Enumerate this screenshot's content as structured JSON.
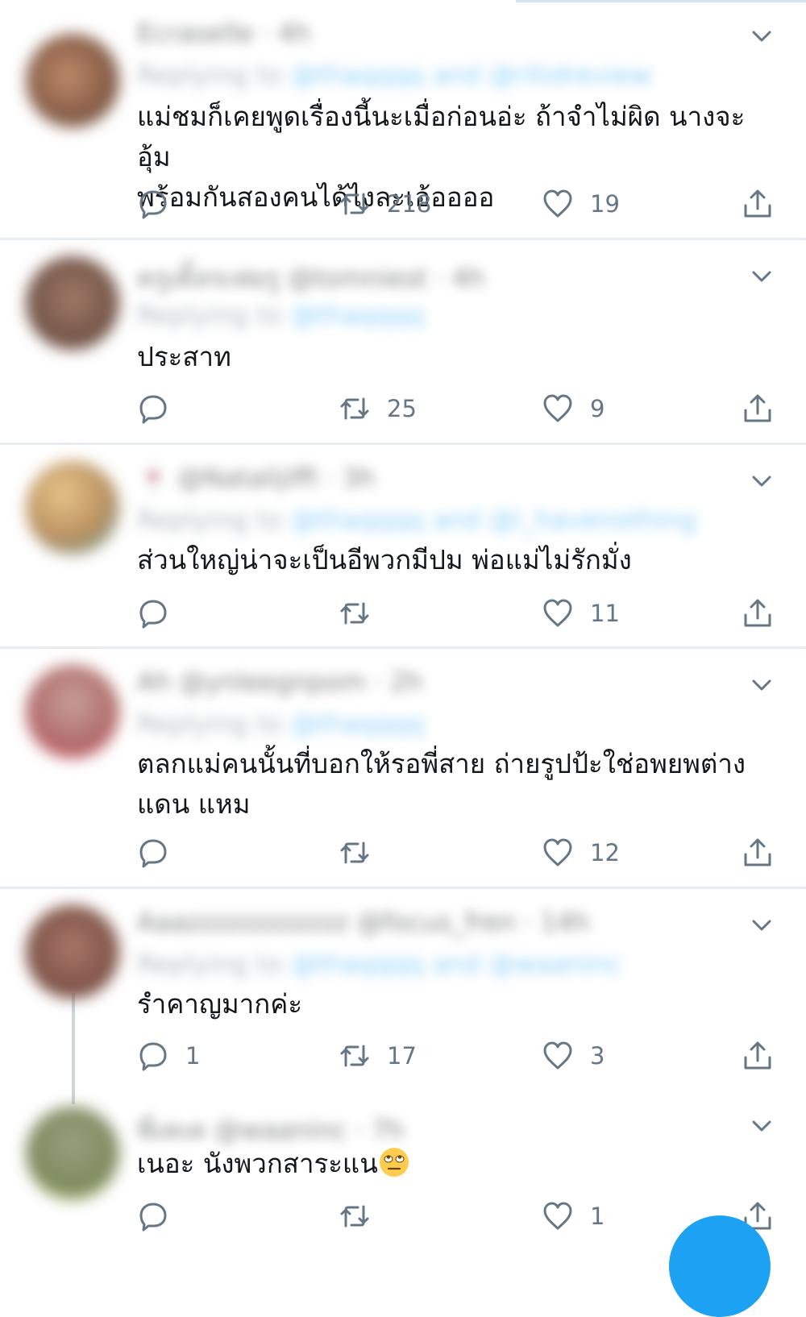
{
  "tweets": [
    {
      "display_name": "Ecraselle",
      "handle_time": "· 4h",
      "replying_prefix": "Replying to",
      "replying_to": "@thaqqqq and @ritidreview",
      "text_lines": [
        "แม่ชมก็เคยพูดเรื่องนี้นะเมื่อก่อนอ่ะ ถ้าจำไม่ผิด นางจะอุ้ม",
        "พร้อมกันสองคนได้ไงละเอ้ออออ"
      ],
      "replies": "",
      "retweets": "218",
      "likes": "19"
    },
    {
      "display_name": "ครูเติ้ลรเฟยรู",
      "handle_time": "@tomniest · 4h",
      "replying_prefix": "Replying to",
      "replying_to": "@thaqqqq",
      "text_lines": [
        "ประสาท"
      ],
      "replies": "",
      "retweets": "25",
      "likes": "9"
    },
    {
      "display_name": "🍷 @Natalijiffi",
      "handle_time": "· 3h",
      "replying_prefix": "Replying to",
      "replying_to": "@thaqqqq and @i_havenothing",
      "text_lines": [
        "ส่วนใหญ่น่าจะเป็นอีพวกมีปม พ่อแม่ไม่รักมั่ง"
      ],
      "replies": "",
      "retweets": "",
      "likes": "11"
    },
    {
      "display_name": "Ah",
      "handle_time": "@ynleegnpom · 2h",
      "replying_prefix": "Replying to",
      "replying_to": "@thaqqqq",
      "text_lines": [
        "ตลกแม่คนนั้นที่บอกให้รอพี่สาย ถ่ายรูปป้ะใช่อพยพต่าง",
        "แดน แหม"
      ],
      "replies": "",
      "retweets": "",
      "likes": "12"
    },
    {
      "display_name": "Aaazzzzzzzzzzzz",
      "handle_time": "@focus_fren · 14h",
      "replying_prefix": "Replying to",
      "replying_to": "@thaqqqq and @waaninc",
      "text_lines": [
        "รำคาญมากค่ะ"
      ],
      "replies": "1",
      "retweets": "17",
      "likes": "3"
    },
    {
      "display_name": "พี่เคเค",
      "handle_time": "@waaninc · 7h",
      "text_lines": [
        "เนอะ นังพวกสาระแน"
      ],
      "replies": "",
      "retweets": "",
      "likes": "1"
    }
  ],
  "icons": {
    "reply": "reply-icon",
    "retweet": "retweet-icon",
    "like": "heart-icon",
    "share": "share-icon",
    "menu": "chevron-down-icon",
    "emoji": "eye-roll-emoji-icon"
  },
  "colors": {
    "icon_gray": "#657786",
    "link_blue": "#1da1f2",
    "divider": "#e6ecf0",
    "fab_blue": "#1da1f2"
  }
}
